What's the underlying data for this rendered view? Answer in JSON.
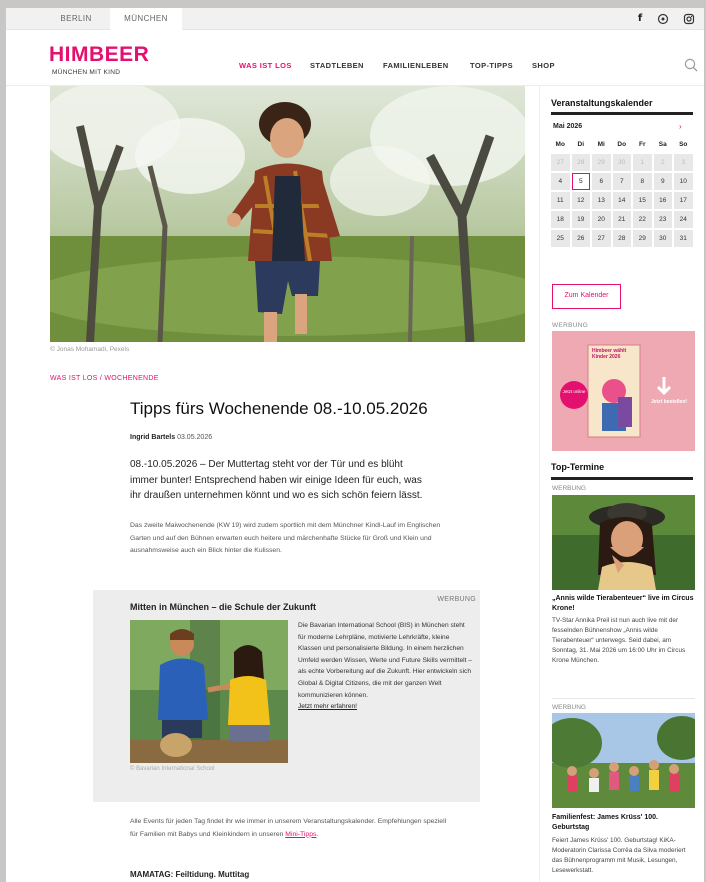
{
  "topbar": {
    "cities": [
      "BERLIN",
      "MÜNCHEN"
    ],
    "social_icons": [
      "facebook-icon",
      "pinterest-icon",
      "instagram-icon"
    ]
  },
  "header": {
    "logo": "HIMBEER",
    "logo_sub": "MÜNCHEN MIT KIND",
    "nav": [
      "WAS IST LOS",
      "STADTLEBEN",
      "FAMILIENLEBEN",
      "TOP-TIPPS",
      "SHOP"
    ],
    "active_nav": "WAS IST LOS"
  },
  "article": {
    "image_credit": "© Jonas Mohamadi, Pexels",
    "category": "WAS IST LOS / WOCHENENDE",
    "title": "Tipps fürs Wochenende 08.-10.05.2026",
    "author": "Ingrid Bartels",
    "date": "03.05.2026",
    "lead": "08.-10.05.2026 – Der Muttertag steht vor der Tür und es blüht immer bunter! Entsprechend haben wir einige Ideen für euch, was ihr draußen unternehmen könnt und wo es sich schön feiern lässt.",
    "body1": "Das zweite Maiwochenende (KW 19) wird zudem sportlich mit dem Münchner Kindl-Lauf im Englischen Garten und auf den Bühnen erwarten euch heitere und märchenhafte Stücke für Groß und Klein und ausnahmsweise auch ein Blick hinter die Kulissen.",
    "body2_pre": "Alle Events für jeden Tag findet ihr wie immer in unserem Veranstaltungskalender. Empfehlungen speziell für Familien mit Babys und Kleinkindern in unseren ",
    "body2_link": "Mini-Tipps",
    "body2_post": ".",
    "body3": "MAMATAG: Feiltidung. Muttitag"
  },
  "ad": {
    "label": "WERBUNG",
    "title": "Mitten in München – die Schule der Zukunft",
    "image_credit": "© Bavarian International School",
    "text": "Die Bavarian International School (BIS) in München steht für moderne Lehrpläne, motivierte Lehrkräfte, kleine Klassen und personalisierte Bildung. In einem herzlichen Umfeld werden Wissen, Werte und Future Skills vermittelt – als echte Vorbereitung auf die Zukunft. Hier entwickeln sich Global & Digital Citizens, die mit der ganzen Welt kommunizieren können.",
    "more_link": "Jetzt mehr erfahren!"
  },
  "sidebar": {
    "calendar_heading": "Veranstaltungskalender",
    "calendar_month": "Mai 2026",
    "calendar_next": "›",
    "weekdays": [
      "Mo",
      "Di",
      "Mi",
      "Do",
      "Fr",
      "Sa",
      "So"
    ],
    "weeks": [
      [
        "27",
        "28",
        "29",
        "30",
        "1",
        "2",
        "3"
      ],
      [
        "4",
        "5",
        "6",
        "7",
        "8",
        "9",
        "10"
      ],
      [
        "11",
        "12",
        "13",
        "14",
        "15",
        "16",
        "17"
      ],
      [
        "18",
        "19",
        "20",
        "21",
        "22",
        "23",
        "24"
      ],
      [
        "25",
        "26",
        "27",
        "28",
        "29",
        "30",
        "31"
      ]
    ],
    "today": "5",
    "calendar_button": "Zum Kalender",
    "ad_label": "WERBUNG",
    "ad_banner_title": "Himbeer wählt Kinder 2026",
    "ad_banner_badge": "Jetzt bestellen!",
    "ad_banner_circle": "Jetzt online",
    "top_heading": "Top-Termine",
    "events": [
      {
        "label": "WERBUNG",
        "title": "„Annis wilde Tierabenteuer“ live im Circus Krone!",
        "text": "TV-Star Annika Preil ist nun auch live mit der fesselnden Bühnenshow „Annis wilde Tierabenteuer“ unterwegs. Seid dabei, am Sonntag, 31. Mai 2026 um 16:00 Uhr im Circus Krone München."
      },
      {
        "label": "WERBUNG",
        "title": "Familienfest: James Krüss' 100. Geburtstag",
        "text": "Feiert James Krüss' 100. Geburtstag! KiKA-Moderatorin Clarissa Corrêa da Silva moderiert das Bühnenprogramm mit Musik, Lesungen, Lesewerkstatt."
      }
    ]
  },
  "colors": {
    "brand": "#e4106f",
    "ad_pink": "#efa9b3"
  }
}
